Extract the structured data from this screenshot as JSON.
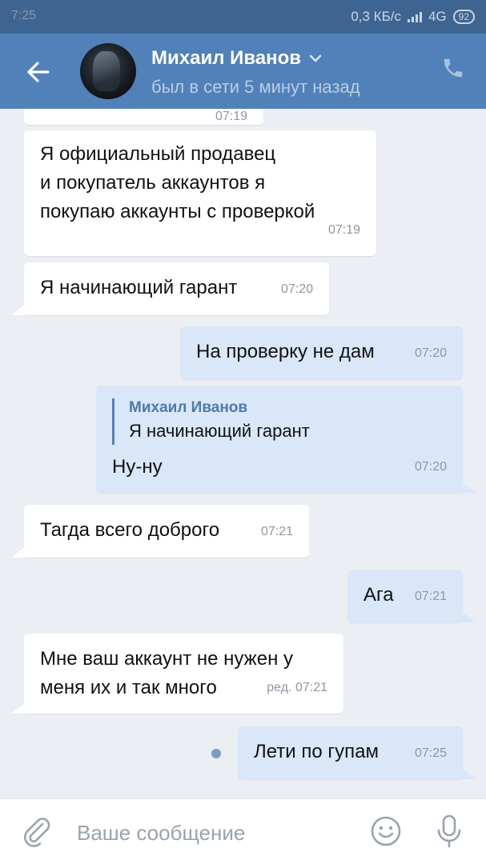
{
  "status_bar": {
    "time": "7:25",
    "network_speed": "0,3 КБ/с",
    "network_type": "4G",
    "battery": "92"
  },
  "header": {
    "name": "Михаил Иванов",
    "status": "был в сети 5 минут назад",
    "icons": {
      "back": "arrow-left-icon",
      "dropdown": "chevron-down-icon",
      "call": "phone-icon"
    }
  },
  "messages": [
    {
      "dir": "in",
      "text_lines": [
        "Я официальный продавец",
        "и покупатель аккаунтов я",
        "покупаю аккаунты с проверкой"
      ],
      "time": "07:19"
    },
    {
      "dir": "in",
      "text_lines": [
        "Я начинающий гарант"
      ],
      "time": "07:20"
    },
    {
      "dir": "out",
      "text_lines": [
        "На проверку не дам"
      ],
      "time": "07:20"
    },
    {
      "dir": "out",
      "reply": {
        "author": "Михаил Иванов",
        "text": "Я начинающий гарант"
      },
      "text_lines": [
        "Ну-ну"
      ],
      "time": "07:20"
    },
    {
      "dir": "in",
      "text_lines": [
        "Тагда всего доброго"
      ],
      "time": "07:21"
    },
    {
      "dir": "out",
      "text_lines": [
        "Ага"
      ],
      "time": "07:21"
    },
    {
      "dir": "in",
      "text_lines": [
        "Мне ваш аккаунт не нужен у",
        "меня их и так много"
      ],
      "time": "ред. 07:21"
    },
    {
      "dir": "out",
      "text_lines": [
        "Лети по гупам"
      ],
      "time": "07:25",
      "unread": true
    }
  ],
  "partial_top_message_time": "07:19",
  "composer": {
    "placeholder": "Ваше сообщение",
    "icons": {
      "attach": "paperclip-icon",
      "emoji": "smile-icon",
      "voice": "microphone-icon"
    }
  },
  "colors": {
    "header": "#5181b8",
    "status_bar": "#3e6592",
    "background": "#ebeef3",
    "incoming": "#ffffff",
    "outgoing": "#d9e7f8",
    "accent": "#5181b8"
  }
}
